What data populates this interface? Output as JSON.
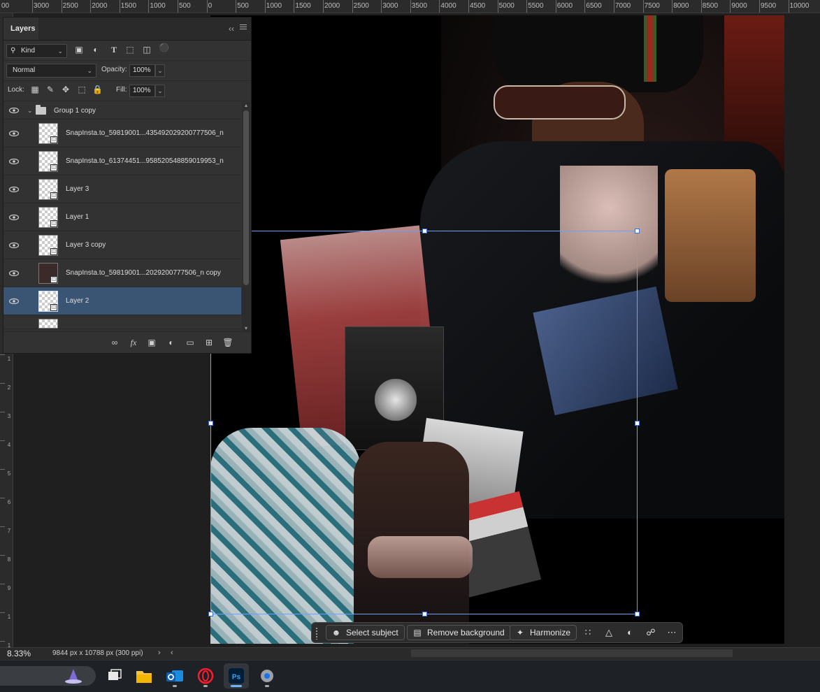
{
  "ruler": {
    "top_labels": [
      "3000",
      "2500",
      "2000",
      "1500",
      "1000",
      "500",
      "0",
      "500",
      "1000",
      "1500",
      "2000",
      "2500",
      "3000",
      "3500",
      "4000",
      "4500",
      "5000",
      "5500",
      "6000",
      "6500",
      "7000",
      "7500",
      "8000",
      "8500",
      "9000",
      "9500",
      "10000"
    ],
    "first_label": "00",
    "left_digits": [
      "1",
      "2",
      "3",
      "4",
      "5",
      "6",
      "7",
      "8",
      "9",
      "1",
      "1"
    ]
  },
  "layers_panel": {
    "tab_label": "Layers",
    "filter_kind": "Kind",
    "blend_mode": "Normal",
    "opacity_label": "Opacity:",
    "opacity_value": "100%",
    "lock_label": "Lock:",
    "fill_label": "Fill:",
    "fill_value": "100%",
    "layers": [
      {
        "name": "Group 1 copy",
        "type": "group",
        "visible": true,
        "selected": false
      },
      {
        "name": "SnapInsta.to_59819001...435492029200777506_n",
        "type": "smart",
        "visible": true,
        "selected": false
      },
      {
        "name": "SnapInsta.to_61374451...958520548859019953_n",
        "type": "smart",
        "visible": true,
        "selected": false
      },
      {
        "name": "Layer 3",
        "type": "smart",
        "visible": true,
        "selected": false
      },
      {
        "name": "Layer 1",
        "type": "smart",
        "visible": true,
        "selected": false
      },
      {
        "name": "Layer 3 copy",
        "type": "smart",
        "visible": true,
        "selected": false
      },
      {
        "name": "SnapInsta.to_59819001...2029200777506_n copy",
        "type": "smart",
        "visible": true,
        "selected": false
      },
      {
        "name": "Layer 2",
        "type": "smart",
        "visible": true,
        "selected": true
      }
    ]
  },
  "contextual_bar": {
    "select_subject": "Select subject",
    "remove_background": "Remove background",
    "harmonize": "Harmonize"
  },
  "status": {
    "zoom": "8.33%",
    "doc_info": "9844 px x 10788 px (300 ppi)"
  },
  "colors": {
    "accent": "#6ea1ff",
    "selected_layer": "#3a5574",
    "panel_bg": "#323232"
  }
}
